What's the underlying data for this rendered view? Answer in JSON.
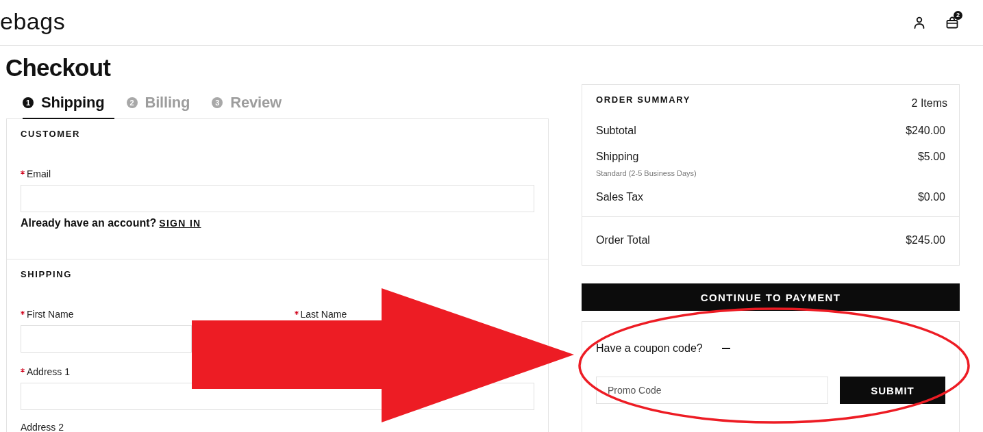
{
  "header": {
    "logo": "ebags",
    "cart_count": "2"
  },
  "page_title": "Checkout",
  "steps": [
    {
      "number": "1",
      "label": "Shipping",
      "selected": true
    },
    {
      "number": "2",
      "label": "Billing",
      "selected": false
    },
    {
      "number": "3",
      "label": "Review",
      "selected": false
    }
  ],
  "customer": {
    "heading": "CUSTOMER",
    "rows": [
      [
        {
          "kind": "input",
          "label": "Email",
          "required": true
        }
      ]
    ],
    "account_prompt": "Already have an account?",
    "sign_in_link": "SIGN IN"
  },
  "shipping": {
    "heading": "SHIPPING",
    "rows": [
      [
        {
          "kind": "input",
          "label": "First Name",
          "required": true
        },
        {
          "kind": "label",
          "label": "Last Name",
          "required": true
        }
      ],
      [
        {
          "kind": "input",
          "label": "Address 1",
          "required": true
        }
      ],
      [
        {
          "kind": "label",
          "label": "Address 2",
          "required": false
        }
      ]
    ]
  },
  "order_summary": {
    "heading": "ORDER SUMMARY",
    "item_count": "2 Items",
    "lines": [
      {
        "label": "Subtotal",
        "value": "$240.00"
      },
      {
        "label": "Shipping",
        "value": "$5.00",
        "note": "Standard (2-5 Business Days)"
      },
      {
        "label": "Sales Tax",
        "value": "$0.00"
      }
    ],
    "total": {
      "label": "Order Total",
      "value": "$245.00"
    }
  },
  "continue_button": "CONTINUE TO PAYMENT",
  "coupon": {
    "prompt": "Have a coupon code?",
    "expanded": true,
    "placeholder": "Promo Code",
    "submit": "SUBMIT"
  }
}
